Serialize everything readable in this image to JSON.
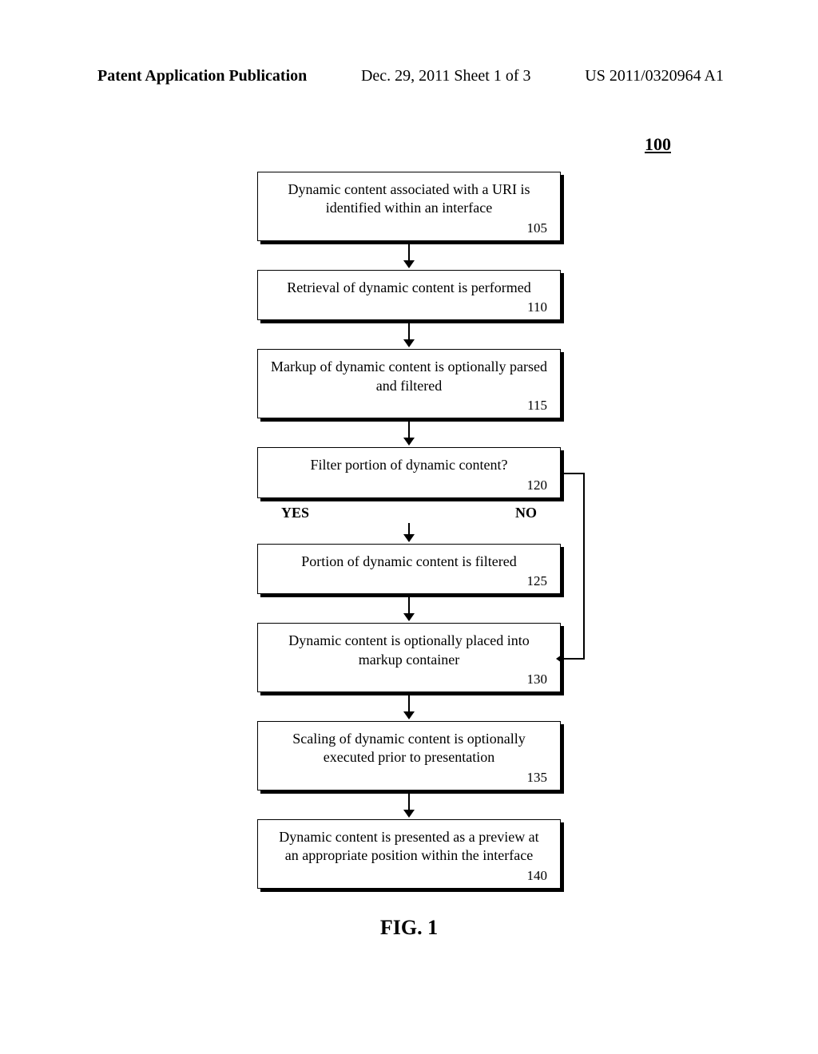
{
  "header": {
    "left": "Patent Application Publication",
    "center": "Dec. 29, 2011  Sheet 1 of 3",
    "right": "US 2011/0320964 A1"
  },
  "figure_label": "100",
  "boxes": {
    "b105": {
      "text": "Dynamic content associated with a URI is identified within an interface",
      "num": "105"
    },
    "b110": {
      "text": "Retrieval of dynamic content is performed",
      "num": "110"
    },
    "b115": {
      "text": "Markup of dynamic content is optionally parsed and filtered",
      "num": "115"
    },
    "b120": {
      "text": "Filter portion of dynamic content?",
      "num": "120"
    },
    "b125": {
      "text": "Portion of dynamic content is filtered",
      "num": "125"
    },
    "b130": {
      "text": "Dynamic content is optionally placed into markup container",
      "num": "130"
    },
    "b135": {
      "text": "Scaling of dynamic content is optionally executed prior to presentation",
      "num": "135"
    },
    "b140": {
      "text": "Dynamic content is presented as a preview at an appropriate position within the interface",
      "num": "140"
    }
  },
  "decision": {
    "yes": "YES",
    "no": "NO"
  },
  "caption": "FIG. 1",
  "chart_data": {
    "type": "flowchart",
    "title": "100",
    "nodes": [
      {
        "id": "105",
        "type": "process",
        "label": "Dynamic content associated with a URI is identified within an interface"
      },
      {
        "id": "110",
        "type": "process",
        "label": "Retrieval of dynamic content is performed"
      },
      {
        "id": "115",
        "type": "process",
        "label": "Markup of dynamic content is optionally parsed and filtered"
      },
      {
        "id": "120",
        "type": "decision",
        "label": "Filter portion of dynamic content?"
      },
      {
        "id": "125",
        "type": "process",
        "label": "Portion of dynamic content is filtered"
      },
      {
        "id": "130",
        "type": "process",
        "label": "Dynamic content is optionally placed into markup container"
      },
      {
        "id": "135",
        "type": "process",
        "label": "Scaling of dynamic content is optionally executed prior to presentation"
      },
      {
        "id": "140",
        "type": "process",
        "label": "Dynamic content is presented as a preview at an appropriate position within the interface"
      }
    ],
    "edges": [
      {
        "from": "105",
        "to": "110",
        "label": ""
      },
      {
        "from": "110",
        "to": "115",
        "label": ""
      },
      {
        "from": "115",
        "to": "120",
        "label": ""
      },
      {
        "from": "120",
        "to": "125",
        "label": "YES"
      },
      {
        "from": "120",
        "to": "130",
        "label": "NO"
      },
      {
        "from": "125",
        "to": "130",
        "label": ""
      },
      {
        "from": "130",
        "to": "135",
        "label": ""
      },
      {
        "from": "135",
        "to": "140",
        "label": ""
      }
    ]
  }
}
